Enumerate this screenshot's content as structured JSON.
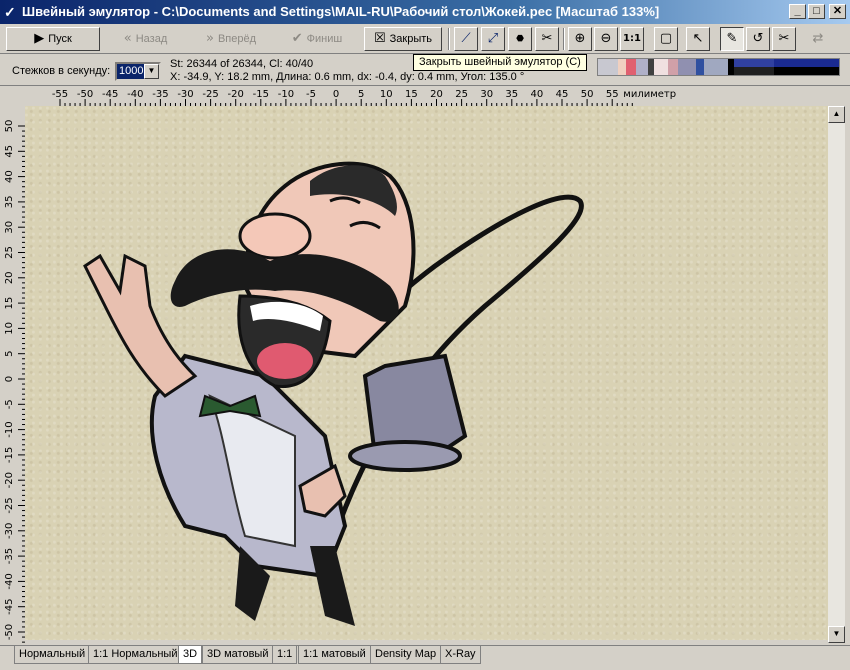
{
  "window": {
    "title": "Швейный эмулятор - C:\\Documents and Settings\\MAIL-RU\\Рабочий стол\\Жокей.pec [Масштаб 133%]",
    "minimize_icon": "minimize-icon",
    "maximize_icon": "maximize-icon",
    "close_icon": "close-icon"
  },
  "toolbar": {
    "start_label": "Пуск",
    "back_label": "Назад",
    "forward_label": "Вперёд",
    "finish_label": "Финиш",
    "close_label": "Закрыть"
  },
  "status": {
    "speed_label": "Стежков в секунду:",
    "speed_value": "1000",
    "info_line1": "St: 26344 of 26344, Cl: 40/40",
    "info_line2": "X: -34.9, Y: 18.2 mm, Длина: 0.6 mm, dx: -0.4, dy: 0.4 mm, Угол: 135.0 °",
    "tooltip": "Закрыть швейный эмулятор (C)"
  },
  "ruler": {
    "unit_label": "милиметр",
    "h_ticks": [
      "-55",
      "-50",
      "-45",
      "-40",
      "-35",
      "-30",
      "-25",
      "-20",
      "-15",
      "-10",
      "-5",
      "0",
      "5",
      "10",
      "15",
      "20",
      "25",
      "30",
      "35",
      "40",
      "45",
      "50",
      "55"
    ],
    "v_ticks": [
      "50",
      "45",
      "40",
      "35",
      "30",
      "25",
      "20",
      "15",
      "10",
      "5",
      "0",
      "-5",
      "-10",
      "-15",
      "-20",
      "-25",
      "-30",
      "-35",
      "-40",
      "-45",
      "-50"
    ]
  },
  "tabs": [
    {
      "label": "Нормальный"
    },
    {
      "label": "1:1 Нормальный"
    },
    {
      "label": "3D"
    },
    {
      "label": "3D матовый"
    },
    {
      "label": "1:1"
    },
    {
      "label": "1:1 матовый"
    },
    {
      "label": "Density Map"
    },
    {
      "label": "X-Ray"
    }
  ],
  "colors": {
    "fabric": "#d9d2b4",
    "title_start": "#0a246a",
    "title_end": "#a6caf0",
    "chrome": "#d4d0c8"
  }
}
